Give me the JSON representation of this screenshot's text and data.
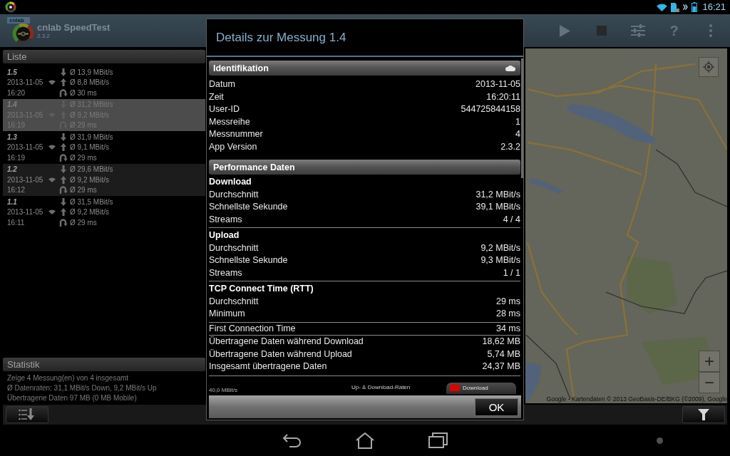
{
  "status_bar": {
    "time": "16:21"
  },
  "app_bar": {
    "logo_text": "cnlab",
    "title": "cnlab SpeedTest",
    "version": "2.3.2",
    "actions": [
      {
        "kind": "play",
        "disabled": false
      },
      {
        "kind": "stop",
        "disabled": true
      },
      {
        "kind": "adjust",
        "disabled": false
      },
      {
        "kind": "help",
        "label": "?",
        "disabled": false
      },
      {
        "kind": "overflow",
        "disabled": false
      }
    ]
  },
  "list_panel": {
    "title": "Liste",
    "items": [
      {
        "id": "1.5",
        "date": "2013-11-05",
        "time": "16:20",
        "download": "Ø 13,9 MBit/s",
        "upload": "Ø 8,8 MBit/s",
        "latency": "Ø 30 ms",
        "selected": false
      },
      {
        "id": "1.4",
        "date": "2013-11-05",
        "time": "16:19",
        "download": "Ø 31,2 MBit/s",
        "upload": "Ø 9,2 MBit/s",
        "latency": "Ø 29 ms",
        "selected": true
      },
      {
        "id": "1.3",
        "date": "2013-11-05",
        "time": "16:19",
        "download": "Ø 31,9 MBit/s",
        "upload": "Ø 9,1 MBit/s",
        "latency": "Ø 29 ms",
        "selected": false
      },
      {
        "id": "1.2",
        "date": "2013-11-05",
        "time": "16:12",
        "download": "Ø 29,6 MBit/s",
        "upload": "Ø 9,2 MBit/s",
        "latency": "Ø 29 ms",
        "selected": false
      },
      {
        "id": "1.1",
        "date": "2013-11-05",
        "time": "16:11",
        "download": "Ø 31,5 MBit/s",
        "upload": "Ø 9,2 MBit/s",
        "latency": "Ø 29 ms",
        "selected": false
      }
    ]
  },
  "statistics_panel": {
    "title": "Statistik",
    "lines": [
      "Zeige 4 Messung(en) von 4 insgesamt",
      "Ø Datenraten: 31,1 MBit/s Down, 9,2 MBit/s Up",
      "Übertragene Daten 97 MB (0 MB Mobile)"
    ]
  },
  "map": {
    "zoom_in": "+",
    "zoom_out": "−",
    "attribution": "Google - Kartendaten © 2013 GeoBasis-DE/BKG (©2009), Google"
  },
  "dialog": {
    "title": "Details zur Messung 1.4",
    "sections": [
      {
        "title": "Identifikation",
        "cloud": true,
        "rows": [
          {
            "label": "Datum",
            "value": "2013-11-05"
          },
          {
            "label": "Zeit",
            "value": "16:20:11"
          },
          {
            "label": "User-ID",
            "value": "544725844158"
          },
          {
            "label": "Messreihe",
            "value": "1"
          },
          {
            "label": "Messnummer",
            "value": "4"
          },
          {
            "label": "App Version",
            "value": "2.3.2"
          }
        ]
      },
      {
        "title": "Performance Daten",
        "cloud": false,
        "groups": [
          {
            "title": "Download",
            "rows": [
              {
                "label": "Durchschnitt",
                "value": "31,2 MBit/s"
              },
              {
                "label": "Schnellste Sekunde",
                "value": "39,1 MBit/s"
              },
              {
                "label": "Streams",
                "value": "4 / 4"
              }
            ]
          },
          {
            "title": "Upload",
            "rows": [
              {
                "label": "Durchschnitt",
                "value": "9,2 MBit/s"
              },
              {
                "label": "Schnellste Sekunde",
                "value": "9,3 MBit/s"
              },
              {
                "label": "Streams",
                "value": "1 / 1"
              }
            ]
          },
          {
            "title": "TCP Connect Time (RTT)",
            "rows": [
              {
                "label": "Durchschnitt",
                "value": "29 ms"
              },
              {
                "label": "Minimum",
                "value": "28 ms"
              }
            ]
          },
          {
            "rows": [
              {
                "label": "First Connection Time",
                "value": "34 ms"
              }
            ]
          },
          {
            "rows": [
              {
                "label": "Übertragene Daten während Download",
                "value": "18,62 MB"
              },
              {
                "label": "Übertragene Daten während Upload",
                "value": "5,74 MB"
              },
              {
                "label": "Insgesamt übertragene Daten",
                "value": "24,37 MB"
              }
            ]
          }
        ]
      }
    ],
    "chart_preview": {
      "axis_label": "40,0 MBit/s",
      "title": "Up- & Download-Raten",
      "legend": [
        {
          "label": "Download",
          "color": "#e00000"
        }
      ]
    },
    "ok_button": "OK"
  }
}
